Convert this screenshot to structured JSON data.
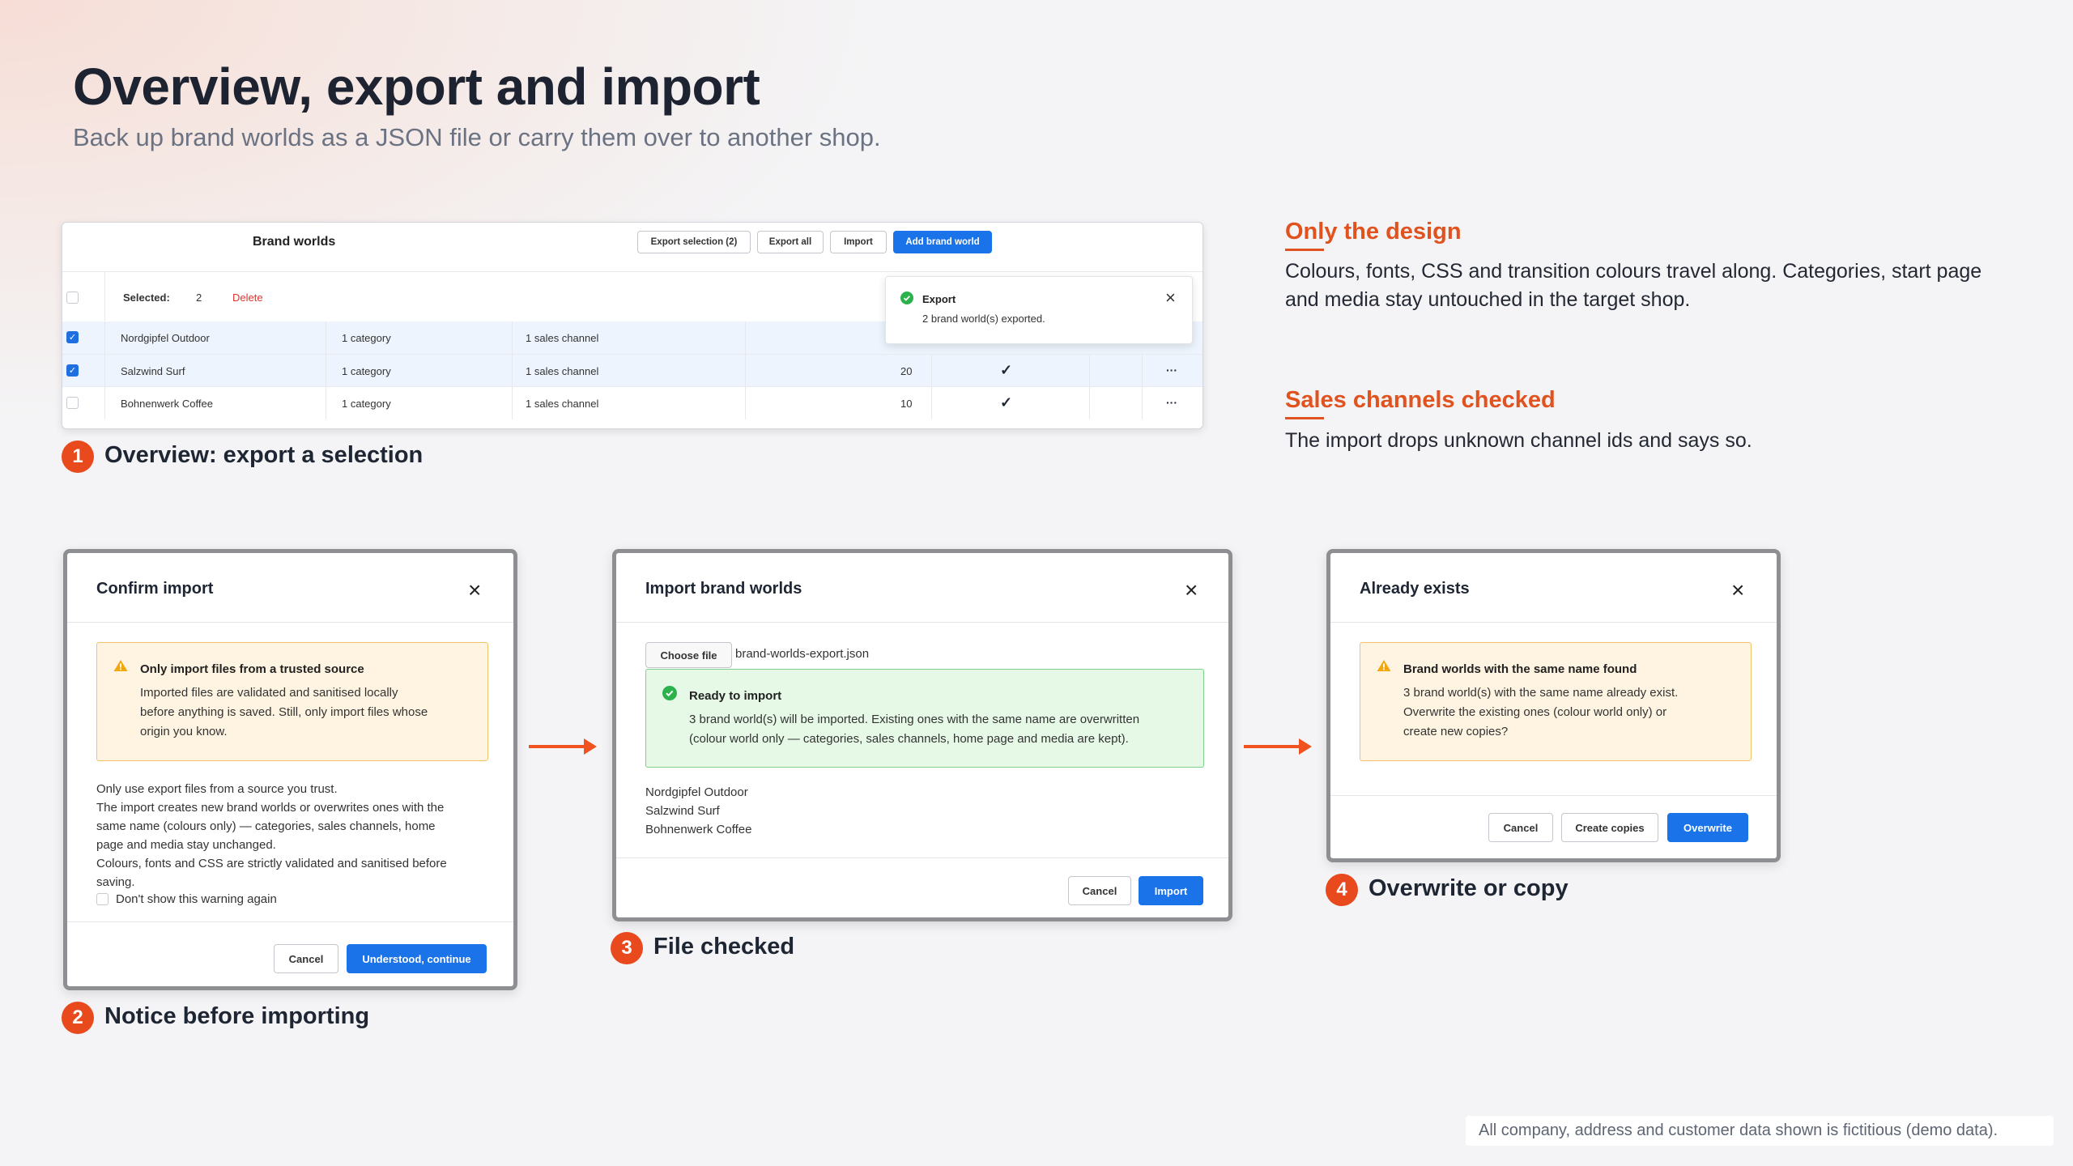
{
  "header": {
    "title": "Overview, export and import",
    "subtitle": "Back up brand worlds as a JSON file or carry them over to another shop."
  },
  "overview": {
    "panel_title": "Brand worlds",
    "buttons": {
      "export_selection": "Export selection (2)",
      "export_all": "Export all",
      "import": "Import",
      "add": "Add brand world"
    },
    "selected_label": "Selected:",
    "selected_count": "2",
    "delete": "Delete",
    "rows": [
      {
        "name": "Nordgipfel Outdoor",
        "categories": "1 category",
        "channels": "1 sales channel",
        "checked": true
      },
      {
        "name": "Salzwind Surf",
        "categories": "1 category",
        "channels": "1 sales channel",
        "number": "20",
        "active": "✓",
        "more": "···",
        "checked": true
      },
      {
        "name": "Bohnenwerk Coffee",
        "categories": "1 category",
        "channels": "1 sales channel",
        "number": "10",
        "active": "✓",
        "more": "···",
        "checked": false
      }
    ],
    "toast": {
      "title": "Export",
      "message": "2 brand world(s) exported.",
      "close": "×"
    }
  },
  "steps": {
    "s1": {
      "num": "1",
      "label": "Overview: export a selection"
    },
    "s2": {
      "num": "2",
      "label": "Notice before importing"
    },
    "s3": {
      "num": "3",
      "label": "File checked"
    },
    "s4": {
      "num": "4",
      "label": "Overwrite or copy"
    }
  },
  "confirm": {
    "title": "Confirm import",
    "close": "×",
    "warn_title": "Only import files from a trusted source",
    "warn_l1": "Imported files are validated and sanitised locally",
    "warn_l2": "before anything is saved. Still, only import files whose",
    "warn_l3": "origin you know.",
    "p1": "Only use export files from a source you trust.",
    "p2": "The import creates new brand worlds or overwrites ones with the",
    "p3": "same name (colours only) — categories, sales channels, home",
    "p4": "page and media stay unchanged.",
    "p5": "Colours, fonts and CSS are strictly validated and sanitised before",
    "p6": "saving.",
    "dont_show": "Don't show this warning again",
    "cancel": "Cancel",
    "continue": "Understood, continue"
  },
  "importdlg": {
    "title": "Import brand worlds",
    "close": "×",
    "choose": "Choose file",
    "filename": "brand-worlds-export.json",
    "ok_title": "Ready to import",
    "ok_l1": "3 brand world(s) will be imported. Existing ones with the same name are overwritten",
    "ok_l2": "(colour world only — categories, sales channels, home page and media are kept).",
    "names": [
      "Nordgipfel Outdoor",
      "Salzwind Surf",
      "Bohnenwerk Coffee"
    ],
    "cancel": "Cancel",
    "import": "Import"
  },
  "exists": {
    "title": "Already exists",
    "close": "×",
    "warn_title": "Brand worlds with the same name found",
    "l1": "3 brand world(s) with the same name already exist.",
    "l2": "Overwrite the existing ones (colour world only) or",
    "l3": "create new copies?",
    "cancel": "Cancel",
    "copies": "Create copies",
    "overwrite": "Overwrite"
  },
  "notes": {
    "n1_title": "Only the design",
    "n1_l1": "Colours, fonts, CSS and transition colours travel along. Categories, start page",
    "n1_l2": "and media stay untouched in the target shop.",
    "n2_title": "Sales channels checked",
    "n2_l1": "The import drops unknown channel ids and says so."
  },
  "footer": "All company, address and customer data shown is fictitious (demo data).",
  "colors": {
    "accent": "#e0531f",
    "primary": "#1a73e8"
  }
}
